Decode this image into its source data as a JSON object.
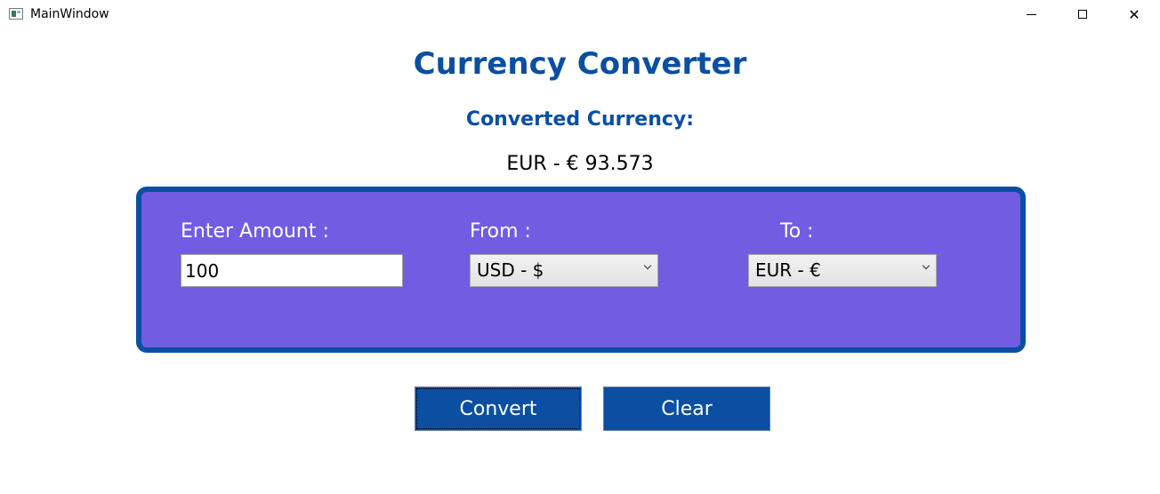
{
  "window": {
    "title": "MainWindow",
    "controls": {
      "minimize_icon": "minimize-icon",
      "maximize_icon": "maximize-icon",
      "close_glyph": "✕"
    }
  },
  "header": {
    "title": "Currency Converter",
    "result_label": "Converted Currency:",
    "result_value": "EUR - € 93.573"
  },
  "form": {
    "amount_label": "Enter Amount :",
    "amount_value": "100",
    "from_label": "From :",
    "from_selected": "USD - $",
    "to_label": "To :",
    "to_selected": "EUR - €"
  },
  "actions": {
    "convert_label": "Convert",
    "clear_label": "Clear"
  },
  "colors": {
    "accent": "#0a4fa2",
    "panel": "#715ce2"
  }
}
